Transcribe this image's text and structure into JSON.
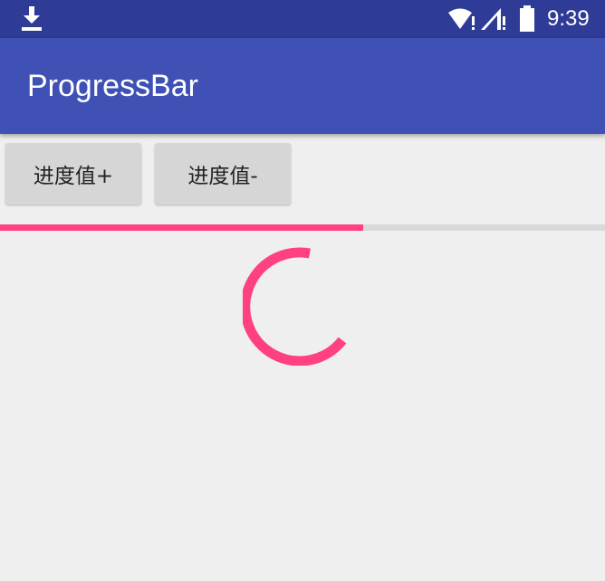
{
  "status_bar": {
    "time": "9:39",
    "icons": [
      "download-icon",
      "wifi-icon",
      "signal-icon",
      "battery-icon"
    ]
  },
  "app_bar": {
    "title": "ProgressBar"
  },
  "buttons": {
    "increase_label": "进度值+",
    "decrease_label": "进度值-"
  },
  "progress": {
    "value_fraction": 0.6
  },
  "colors": {
    "status_bar": "#2f3c97",
    "app_bar": "#3f51b5",
    "accent": "#ff4081",
    "background": "#efefef"
  }
}
